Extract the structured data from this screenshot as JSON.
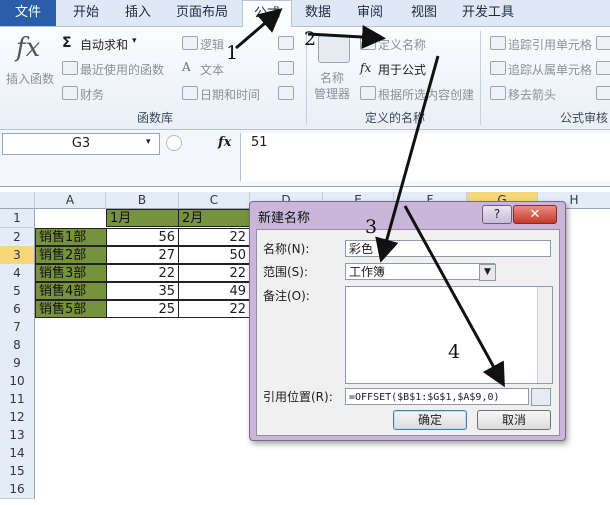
{
  "ribbon_tabs": [
    "文件",
    "开始",
    "插入",
    "页面布局",
    "公式",
    "数据",
    "审阅",
    "视图",
    "开发工具"
  ],
  "ribbon": {
    "insert_function": "插入函数",
    "autosum": "自动求和",
    "recent": "最近使用的函数",
    "finance": "财务",
    "logical": "逻辑",
    "text": "文本",
    "datetime": "日期和时间",
    "function_library": "函数库",
    "name_manager_line1": "名称",
    "name_manager_line2": "管理器",
    "define_name": "定义名称",
    "use_in_formula": "用于公式",
    "create_from_selection": "根据所选内容创建",
    "defined_names": "定义的名称",
    "trace_precedents": "追踪引用单元格",
    "trace_dependents": "追踪从属单元格",
    "remove_arrows": "移去箭头",
    "formula_auditing": "公式审核"
  },
  "formula_bar": {
    "name_box": "G3",
    "fx": "fx",
    "value": "51"
  },
  "columns": [
    "A",
    "B",
    "C",
    "D",
    "E",
    "F",
    "G",
    "H"
  ],
  "rows": [
    "1",
    "2",
    "3",
    "4",
    "5",
    "6",
    "7",
    "8",
    "9",
    "10",
    "11",
    "12",
    "13",
    "14",
    "15",
    "16"
  ],
  "sheet": {
    "header_b": "1月",
    "header_c": "2月",
    "data": [
      {
        "name": "销售1部",
        "b": "56",
        "c": "22"
      },
      {
        "name": "销售2部",
        "b": "27",
        "c": "50"
      },
      {
        "name": "销售3部",
        "b": "22",
        "c": "22"
      },
      {
        "name": "销售4部",
        "b": "35",
        "c": "49"
      },
      {
        "name": "销售5部",
        "b": "25",
        "c": "22"
      }
    ]
  },
  "dialog": {
    "title": "新建名称",
    "help": "?",
    "close": "✕",
    "name_label": "名称(N):",
    "name_value": "彩色",
    "scope_label": "范围(S):",
    "scope_value": "工作簿",
    "comment_label": "备注(O):",
    "refers_label": "引用位置(R):",
    "refers_value": "=OFFSET($B$1:$G$1,$A$9,0)",
    "ok": "确定",
    "cancel": "取消"
  },
  "steps": [
    "1",
    "2",
    "3",
    "4"
  ],
  "colors": {
    "accent": "#2a5ea9",
    "green_fill": "#76923c",
    "dialog_frame": "#c9b6d8",
    "selected_col": "#f6d77a"
  }
}
